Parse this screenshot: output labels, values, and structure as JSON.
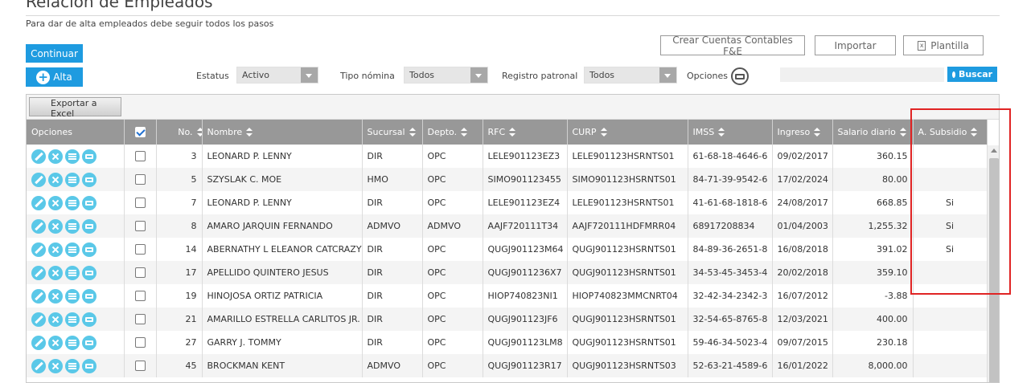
{
  "header": {
    "title": "Relación de Empleados",
    "subtitle": "Para dar de alta empleados debe seguir todos los pasos"
  },
  "toolbar": {
    "continuar_label": "Continuar",
    "alta_label": "Alta",
    "crear_cuentas_label": "Crear Cuentas Contables F&E",
    "importar_label": "Importar",
    "plantilla_label": "Plantilla",
    "buscar_label": "Buscar",
    "exportar_label": "Exportar a Excel"
  },
  "filters": {
    "estatus_label": "Estatus",
    "estatus_value": "Activo",
    "tipo_nomina_label": "Tipo nómina",
    "tipo_nomina_value": "Todos",
    "registro_patronal_label": "Registro patronal",
    "registro_patronal_value": "Todos",
    "opciones_label": "Opciones"
  },
  "search": {
    "placeholder": ""
  },
  "colors": {
    "accent": "#1e9be0",
    "action_icon": "#5ac8e8",
    "header_bg": "#989898",
    "highlight": "#e02424"
  },
  "table": {
    "columns": [
      "Opciones",
      "No.",
      "Nombre",
      "Sucursal",
      "Depto.",
      "RFC",
      "CURP",
      "IMSS",
      "Ingreso",
      "Salario diario",
      "A. Subsidio"
    ],
    "rows": [
      {
        "no": "3",
        "nombre": "LEONARD P. LENNY",
        "sucursal": "DIR",
        "depto": "OPC",
        "rfc": "LELE901123EZ3",
        "curp": "LELE901123HSRNTS01",
        "imss": "61-68-18-4646-6",
        "ingreso": "09/02/2017",
        "salario": "360.15",
        "subsidio": ""
      },
      {
        "no": "5",
        "nombre": "SZYSLAK C. MOE",
        "sucursal": "HMO",
        "depto": "OPC",
        "rfc": "SIMO901123455",
        "curp": "SIMO901123HSRNTS01",
        "imss": "84-71-39-9542-6",
        "ingreso": "17/02/2024",
        "salario": "80.00",
        "subsidio": ""
      },
      {
        "no": "7",
        "nombre": "LEONARD P. LENNY",
        "sucursal": "DIR",
        "depto": "OPC",
        "rfc": "LELE901123EZ4",
        "curp": "LELE901123HSRNTS01",
        "imss": "41-61-68-1818-6",
        "ingreso": "24/08/2017",
        "salario": "668.85",
        "subsidio": "Si"
      },
      {
        "no": "8",
        "nombre": "AMARO JARQUIN FERNANDO",
        "sucursal": "ADMVO",
        "depto": "ADMVO",
        "rfc": "AAJF720111T34",
        "curp": "AAJF720111HDFMRR04",
        "imss": "68917208834",
        "ingreso": "01/04/2003",
        "salario": "1,255.32",
        "subsidio": "Si"
      },
      {
        "no": "14",
        "nombre": "ABERNATHY L ELEANOR CATCRAZY",
        "sucursal": "DIR",
        "depto": "OPC",
        "rfc": "QUGJ901123M64",
        "curp": "QUGJ901123HSRNTS01",
        "imss": "84-89-36-2651-8",
        "ingreso": "16/08/2018",
        "salario": "391.02",
        "subsidio": "Si"
      },
      {
        "no": "17",
        "nombre": "APELLIDO QUINTERO JESUS",
        "sucursal": "DIR",
        "depto": "OPC",
        "rfc": "QUGJ9011236X7",
        "curp": "QUGJ901123HSRNTS01",
        "imss": "34-53-45-3453-4",
        "ingreso": "20/02/2018",
        "salario": "359.10",
        "subsidio": ""
      },
      {
        "no": "19",
        "nombre": "HINOJOSA ORTIZ PATRICIA",
        "sucursal": "DIR",
        "depto": "OPC",
        "rfc": "HIOP740823NI1",
        "curp": "HIOP740823MMCNRT04",
        "imss": "32-42-34-2342-3",
        "ingreso": "16/07/2012",
        "salario": "-3.88",
        "subsidio": ""
      },
      {
        "no": "21",
        "nombre": "AMARILLO ESTRELLA CARLITOS JR.",
        "sucursal": "DIR",
        "depto": "OPC",
        "rfc": "QUGJ901123JF6",
        "curp": "QUGJ901123HSRNTS01",
        "imss": "32-54-65-8765-8",
        "ingreso": "12/03/2021",
        "salario": "400.00",
        "subsidio": ""
      },
      {
        "no": "27",
        "nombre": "GARRY J. TOMMY",
        "sucursal": "DIR",
        "depto": "OPC",
        "rfc": "QUGJ901123LM8",
        "curp": "QUGJ901123HSRNTS01",
        "imss": "59-46-34-5023-4",
        "ingreso": "09/07/2015",
        "salario": "230.18",
        "subsidio": ""
      },
      {
        "no": "45",
        "nombre": "BROCKMAN KENT",
        "sucursal": "ADMVO",
        "depto": "OPC",
        "rfc": "QUGJ901123R17",
        "curp": "QUGJ901123HSRNTS03",
        "imss": "52-63-21-4589-6",
        "ingreso": "16/01/2022",
        "salario": "8,000.00",
        "subsidio": ""
      }
    ]
  },
  "icons": {
    "alta": "plus-circle-icon",
    "plantilla": "excel-file-icon",
    "opciones": "print-icon",
    "buscar": "search-icon",
    "row_actions": [
      "edit-icon",
      "delete-icon",
      "list-icon",
      "print-icon"
    ]
  }
}
